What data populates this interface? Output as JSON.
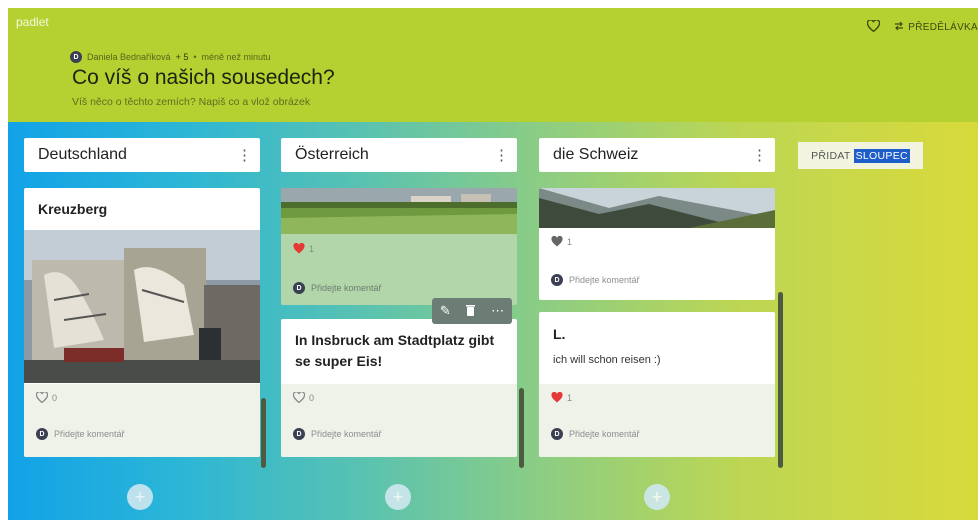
{
  "app": {
    "brand": "padlet",
    "remake_label": "PŘEDĚLÁVKA"
  },
  "header": {
    "author_initial": "D",
    "author": "Daniela Bednaříková",
    "plus_count": "+ 5",
    "separator": "•",
    "time": "méně než minutu",
    "title": "Co víš o našich sousedech?",
    "subtitle": "Víš něco o těchto zemích? Napiš co a vlož obrázek"
  },
  "columns": [
    {
      "name": "Deutschland",
      "card": {
        "title": "Kreuzberg",
        "likes": "0",
        "comment_placeholder": "Přidejte komentář"
      }
    },
    {
      "name": "Österreich",
      "card1": {
        "likes": "1",
        "comment_placeholder": "Přidejte komentář"
      },
      "card2": {
        "title": "In Insbruck am Stadtplatz gibt se super Eis!",
        "likes": "0",
        "comment_placeholder": "Přidejte komentář"
      }
    },
    {
      "name": "die Schweiz",
      "card1": {
        "likes": "1",
        "comment_placeholder": "Přidejte komentář"
      },
      "card2": {
        "title": "L.",
        "body": "ich will schon reisen :)",
        "likes": "1",
        "comment_placeholder": "Přidejte komentář"
      }
    }
  ],
  "add_column": {
    "label_part1": "PŘIDAT",
    "label_part2": "SLOUPEC"
  },
  "avatar_initial": "D",
  "colors": {
    "header_bg": "#b4d131",
    "like_active": "#e53935",
    "selection": "#1f5ec8"
  }
}
